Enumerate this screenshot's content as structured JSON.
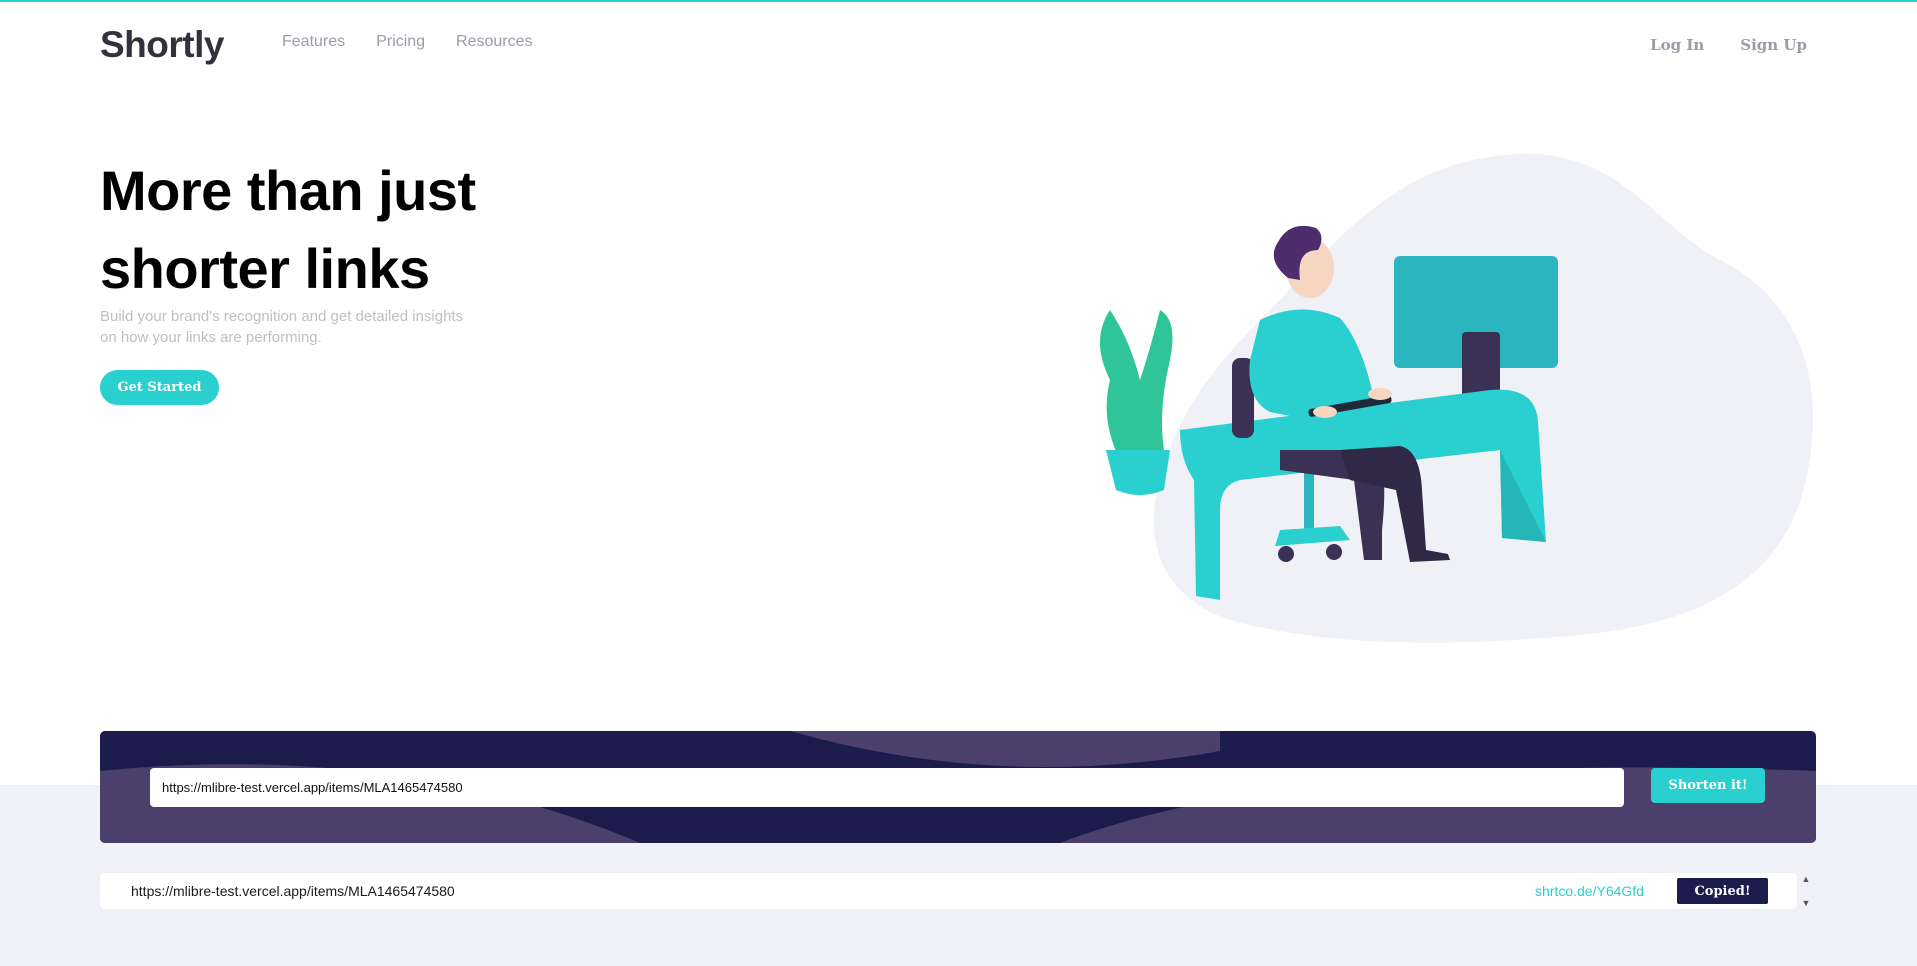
{
  "brand": {
    "logo": "Shortly",
    "accent": "#2acfcf",
    "dark_violet": "#1b1b4c",
    "heading_color": "#34313d"
  },
  "nav": {
    "items": [
      "Features",
      "Pricing",
      "Resources"
    ]
  },
  "auth": {
    "login": "Log In",
    "signup": "Sign Up"
  },
  "hero": {
    "title_line1": "More than just",
    "title_line2": "shorter links",
    "subtitle": "Build your brand's recognition and get detailed insights on how your links are performing.",
    "cta": "Get Started"
  },
  "shorten": {
    "input_value": "https://mlibre-test.vercel.app/items/MLA1465474580",
    "button": "Shorten it!"
  },
  "result": {
    "original": "https://mlibre-test.vercel.app/items/MLA1465474580",
    "short": "shrtco.de/Y64Gfd",
    "copy_button": "Copied!"
  },
  "icons": {
    "spinner_up": "▲",
    "spinner_down": "▼"
  }
}
